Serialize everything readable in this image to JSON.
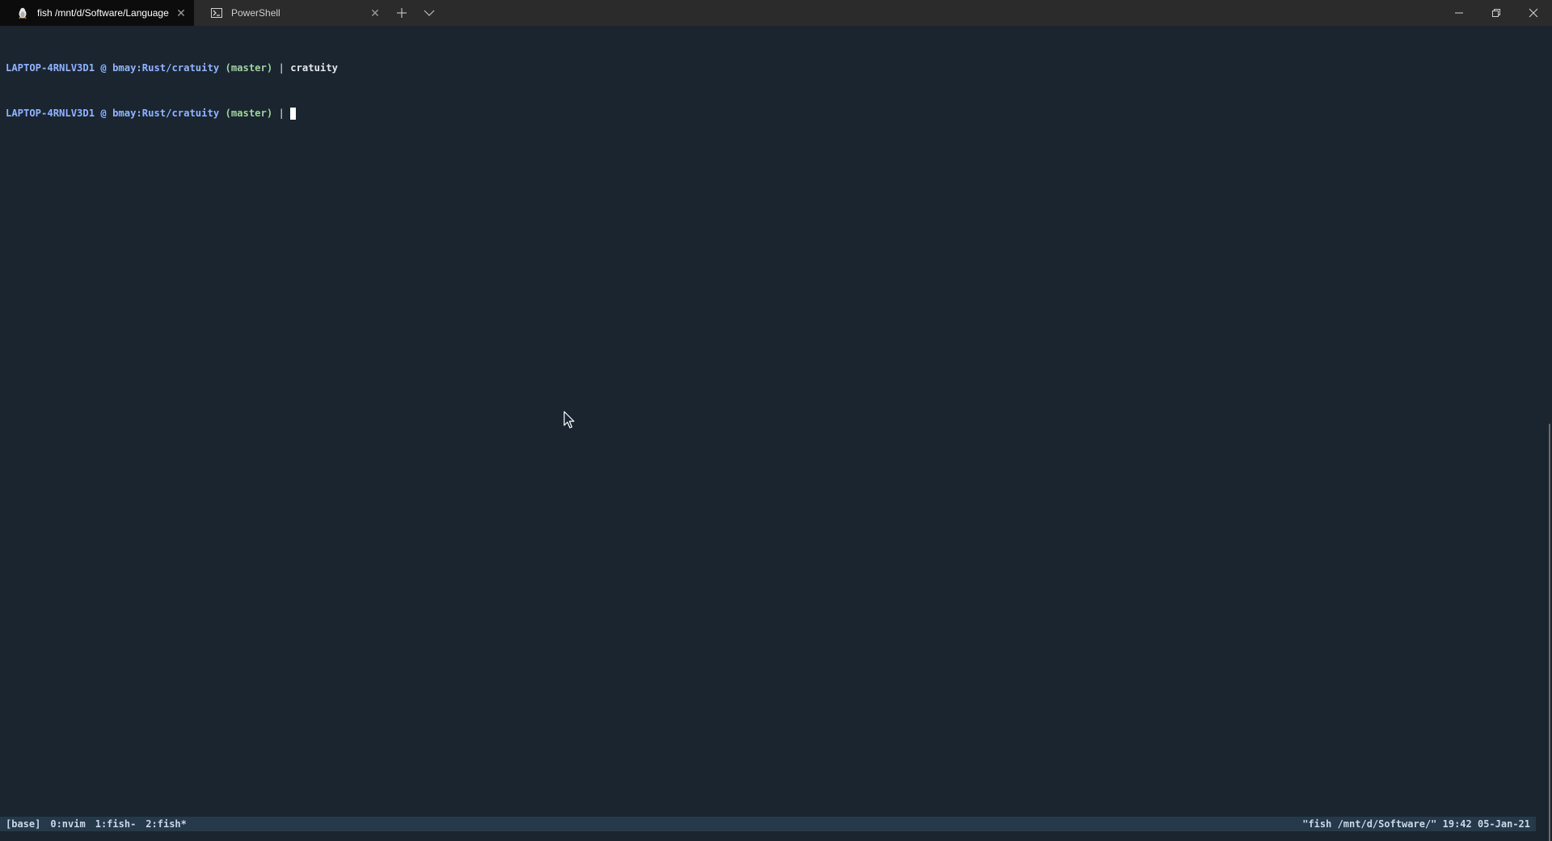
{
  "tabs": [
    {
      "label": "fish /mnt/d/Software/Language",
      "icon": "linux-penguin-icon",
      "active": true
    },
    {
      "label": "PowerShell",
      "icon": "powershell-icon",
      "active": false
    }
  ],
  "terminal": {
    "lines": [
      {
        "host": "LAPTOP-4RNLV3D1 @ ",
        "path": "bmay:Rust/cratuity",
        "branch": " (master)",
        "pipe": " | ",
        "cmd": "cratuity"
      },
      {
        "host": "LAPTOP-4RNLV3D1 @ ",
        "path": "bmay:Rust/cratuity",
        "branch": " (master)",
        "pipe": " | ",
        "cmd": ""
      }
    ]
  },
  "status_bar": {
    "session": "[base]",
    "windows": [
      "0:nvim",
      "1:fish-",
      "2:fish*"
    ],
    "right": "\"fish /mnt/d/Software/\" 19:42 05-Jan-21"
  },
  "colors": {
    "background": "#1b2530",
    "prompt": "#8fb4ff",
    "branch": "#9fd39f",
    "status_bg": "#26394a"
  }
}
